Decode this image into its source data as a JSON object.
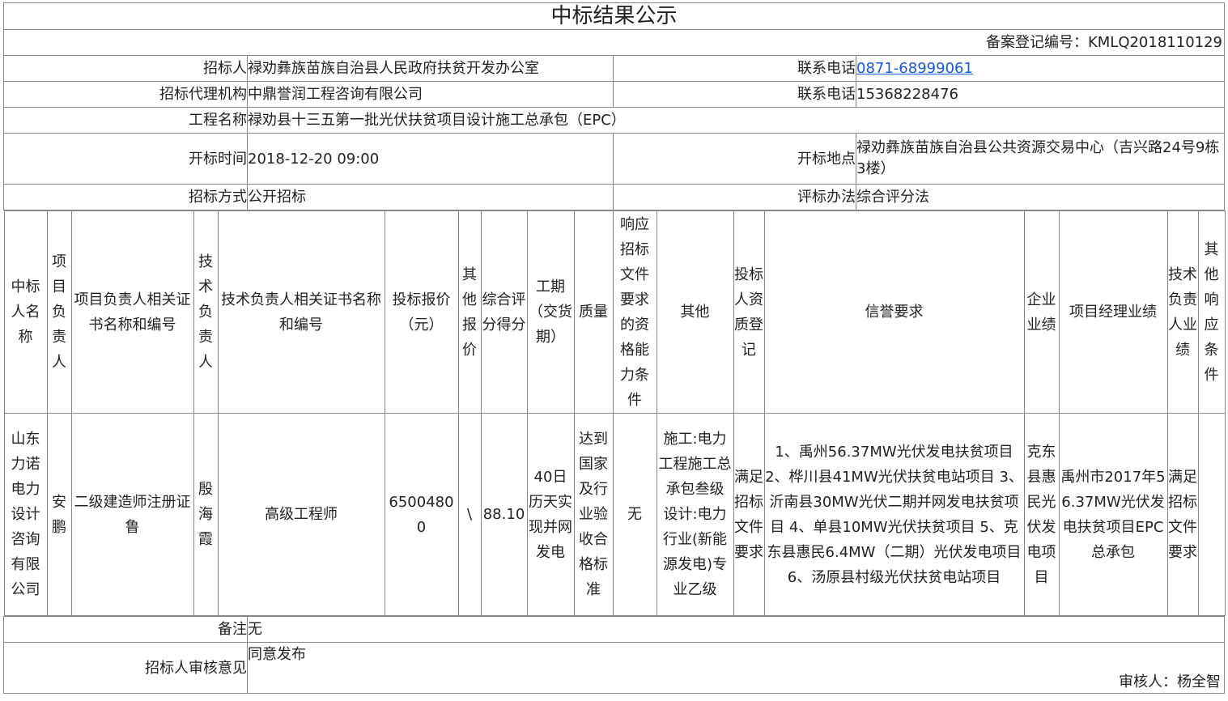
{
  "title": "中标结果公示",
  "registration": "备案登记编号：KMLQ2018110129",
  "rows": {
    "tenderer_label": "招标人",
    "tenderer_value": "禄劝彝族苗族自治县人民政府扶贫开发办公室",
    "phone1_label": "联系电话",
    "phone1_value": "0871-68999061",
    "agency_label": "招标代理机构",
    "agency_value": "中鼎誉润工程咨询有限公司",
    "phone2_label": "联系电话",
    "phone2_value": "15368228476",
    "project_label": "工程名称",
    "project_value": "禄劝县十三五第一批光伏扶贫项目设计施工总承包（EPC）",
    "open_time_label": "开标时间",
    "open_time_value": "2018-12-20 09:00",
    "open_place_label": "开标地点",
    "open_place_value": "禄劝彝族苗族自治县公共资源交易中心（吉兴路24号9栋3楼）",
    "method_label": "招标方式",
    "method_value": "公开招标",
    "eval_label": "评标办法",
    "eval_value": "综合评分法"
  },
  "bid_table": {
    "headers": [
      "中标人名称",
      "项目负责人",
      "项目负责人相关证书名称和编号",
      "技术负责人",
      "技术负责人相关证书名称和编号",
      "投标报价（元）",
      "其他报价",
      "综合评分得分",
      "工期（交货期）",
      "质量",
      "响应招标文件要求的资格能力条件",
      "其他",
      "投标人资质登记",
      "信誉要求",
      "企业业绩",
      "项目经理业绩",
      "技术负责人业绩",
      "其他响应条件"
    ],
    "row": [
      "山东力诺电力设计咨询有限公司",
      "安鹏",
      "二级建造师注册证鲁",
      "殷海霞",
      "高级工程师",
      "65004800",
      "\\",
      "88.10",
      "40日历天实现并网发电",
      "达到国家及行业验收合格标准",
      "无",
      "施工:电力工程施工总承包叁级 设计:电力行业(新能源发电)专业乙级",
      "满足招标文件要求",
      "1、禹州56.37MW光伏发电扶贫项目 2、桦川县41MW光伏扶贫电站项目 3、沂南县30MW光伏二期并网发电扶贫项目 4、单县10MW光伏扶贫项目 5、克东县惠民6.4MW（二期）光伏发电项目 6、汤原县村级光伏扶贫电站项目",
      "克东县惠民光伏发电项目",
      "禹州市2017年56.37MW光伏发电扶贫项目EPC总承包",
      "满足招标文件要求",
      ""
    ]
  },
  "remarks_label": "备注",
  "remarks_value": "无",
  "opinion_label": "招标人审核意见",
  "opinion_value": "同意发布",
  "reviewer": "审核人：杨全智"
}
